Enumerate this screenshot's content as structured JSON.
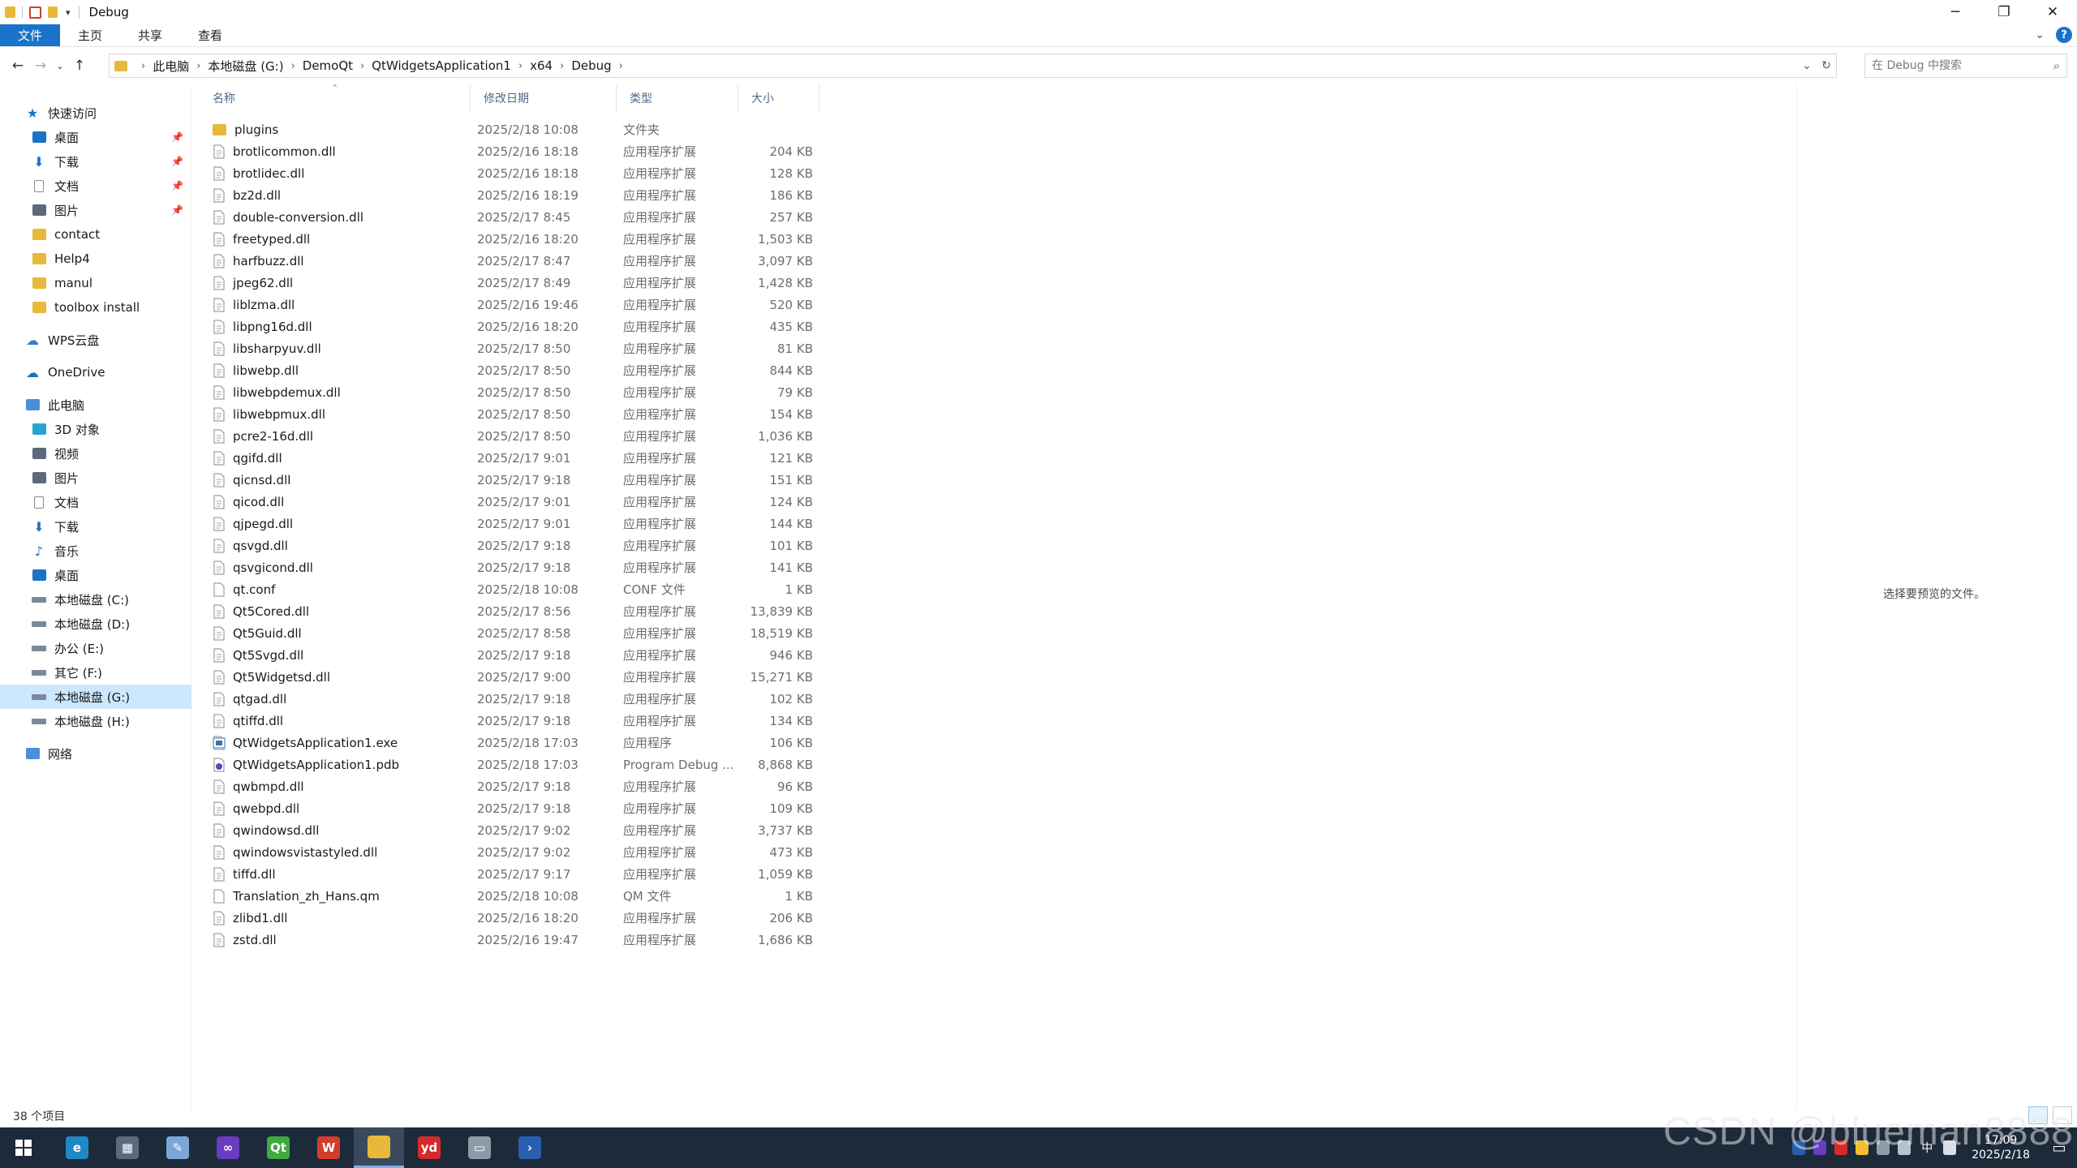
{
  "window": {
    "title": "Debug",
    "minimize": "─",
    "restore": "❐",
    "close": "✕"
  },
  "ribbon": {
    "tabs": [
      "文件",
      "主页",
      "共享",
      "查看"
    ],
    "help": "?"
  },
  "address": {
    "crumbs": [
      "此电脑",
      "本地磁盘 (G:)",
      "DemoQt",
      "QtWidgetsApplication1",
      "x64",
      "Debug"
    ]
  },
  "search": {
    "placeholder": "在 Debug 中搜索"
  },
  "sidebar": {
    "items": [
      {
        "label": "快速访问",
        "icon": "star-icon",
        "color": "#1a73c8",
        "pinned": false
      },
      {
        "label": "桌面",
        "icon": "desktop-icon",
        "color": "#1a73c8",
        "pinned": true
      },
      {
        "label": "下载",
        "icon": "download-icon",
        "color": "#1a73c8",
        "pinned": true
      },
      {
        "label": "文档",
        "icon": "document-icon",
        "color": "#8a8a8a",
        "pinned": true
      },
      {
        "label": "图片",
        "icon": "picture-icon",
        "color": "#5a6a7a",
        "pinned": true
      },
      {
        "label": "contact",
        "icon": "folder-icon",
        "color": "#e8b83a",
        "pinned": false
      },
      {
        "label": "Help4",
        "icon": "folder-icon",
        "color": "#e8b83a",
        "pinned": false
      },
      {
        "label": "manul",
        "icon": "folder-icon",
        "color": "#e8b83a",
        "pinned": false
      },
      {
        "label": "toolbox install",
        "icon": "folder-icon",
        "color": "#e8b83a",
        "pinned": false
      },
      {
        "label": "WPS云盘",
        "icon": "cloud-icon",
        "color": "#2f7ed8",
        "pinned": false
      },
      {
        "label": "OneDrive",
        "icon": "onedrive-icon",
        "color": "#1a73c8",
        "pinned": false
      },
      {
        "label": "此电脑",
        "icon": "computer-icon",
        "color": "#4a90d9",
        "pinned": false
      },
      {
        "label": "3D 对象",
        "icon": "3d-objects-icon",
        "color": "#29a3d6",
        "pinned": false
      },
      {
        "label": "视频",
        "icon": "video-icon",
        "color": "#5a6a7a",
        "pinned": false
      },
      {
        "label": "图片",
        "icon": "picture-icon",
        "color": "#5a6a7a",
        "pinned": false
      },
      {
        "label": "文档",
        "icon": "document-icon",
        "color": "#8a8a8a",
        "pinned": false
      },
      {
        "label": "下载",
        "icon": "download-icon",
        "color": "#1a73c8",
        "pinned": false
      },
      {
        "label": "音乐",
        "icon": "music-icon",
        "color": "#1a73c8",
        "pinned": false
      },
      {
        "label": "桌面",
        "icon": "desktop-icon",
        "color": "#1a73c8",
        "pinned": false
      },
      {
        "label": "本地磁盘 (C:)",
        "icon": "drive-icon",
        "color": "#7a8a9a",
        "pinned": false
      },
      {
        "label": "本地磁盘 (D:)",
        "icon": "drive-icon",
        "color": "#7a8a9a",
        "pinned": false
      },
      {
        "label": "办公 (E:)",
        "icon": "drive-icon",
        "color": "#7a8a9a",
        "pinned": false
      },
      {
        "label": "其它 (F:)",
        "icon": "drive-icon",
        "color": "#7a8a9a",
        "pinned": false
      },
      {
        "label": "本地磁盘 (G:)",
        "icon": "drive-icon",
        "color": "#7a8a9a",
        "pinned": false,
        "selected": true
      },
      {
        "label": "本地磁盘 (H:)",
        "icon": "drive-icon",
        "color": "#7a8a9a",
        "pinned": false
      },
      {
        "label": "网络",
        "icon": "network-icon",
        "color": "#4a90d9",
        "pinned": false
      }
    ]
  },
  "filelist": {
    "columns": [
      "名称",
      "修改日期",
      "类型",
      "大小"
    ],
    "files": [
      {
        "name": "plugins",
        "date": "2025/2/18 10:08",
        "type": "文件夹",
        "size": "",
        "icon": "folder-icon"
      },
      {
        "name": "brotlicommon.dll",
        "date": "2025/2/16 18:18",
        "type": "应用程序扩展",
        "size": "204 KB",
        "icon": "dll-icon"
      },
      {
        "name": "brotlidec.dll",
        "date": "2025/2/16 18:18",
        "type": "应用程序扩展",
        "size": "128 KB",
        "icon": "dll-icon"
      },
      {
        "name": "bz2d.dll",
        "date": "2025/2/16 18:19",
        "type": "应用程序扩展",
        "size": "186 KB",
        "icon": "dll-icon"
      },
      {
        "name": "double-conversion.dll",
        "date": "2025/2/17 8:45",
        "type": "应用程序扩展",
        "size": "257 KB",
        "icon": "dll-icon"
      },
      {
        "name": "freetyped.dll",
        "date": "2025/2/16 18:20",
        "type": "应用程序扩展",
        "size": "1,503 KB",
        "icon": "dll-icon"
      },
      {
        "name": "harfbuzz.dll",
        "date": "2025/2/17 8:47",
        "type": "应用程序扩展",
        "size": "3,097 KB",
        "icon": "dll-icon"
      },
      {
        "name": "jpeg62.dll",
        "date": "2025/2/17 8:49",
        "type": "应用程序扩展",
        "size": "1,428 KB",
        "icon": "dll-icon"
      },
      {
        "name": "liblzma.dll",
        "date": "2025/2/16 19:46",
        "type": "应用程序扩展",
        "size": "520 KB",
        "icon": "dll-icon"
      },
      {
        "name": "libpng16d.dll",
        "date": "2025/2/16 18:20",
        "type": "应用程序扩展",
        "size": "435 KB",
        "icon": "dll-icon"
      },
      {
        "name": "libsharpyuv.dll",
        "date": "2025/2/17 8:50",
        "type": "应用程序扩展",
        "size": "81 KB",
        "icon": "dll-icon"
      },
      {
        "name": "libwebp.dll",
        "date": "2025/2/17 8:50",
        "type": "应用程序扩展",
        "size": "844 KB",
        "icon": "dll-icon"
      },
      {
        "name": "libwebpdemux.dll",
        "date": "2025/2/17 8:50",
        "type": "应用程序扩展",
        "size": "79 KB",
        "icon": "dll-icon"
      },
      {
        "name": "libwebpmux.dll",
        "date": "2025/2/17 8:50",
        "type": "应用程序扩展",
        "size": "154 KB",
        "icon": "dll-icon"
      },
      {
        "name": "pcre2-16d.dll",
        "date": "2025/2/17 8:50",
        "type": "应用程序扩展",
        "size": "1,036 KB",
        "icon": "dll-icon"
      },
      {
        "name": "qgifd.dll",
        "date": "2025/2/17 9:01",
        "type": "应用程序扩展",
        "size": "121 KB",
        "icon": "dll-icon"
      },
      {
        "name": "qicnsd.dll",
        "date": "2025/2/17 9:18",
        "type": "应用程序扩展",
        "size": "151 KB",
        "icon": "dll-icon"
      },
      {
        "name": "qicod.dll",
        "date": "2025/2/17 9:01",
        "type": "应用程序扩展",
        "size": "124 KB",
        "icon": "dll-icon"
      },
      {
        "name": "qjpegd.dll",
        "date": "2025/2/17 9:01",
        "type": "应用程序扩展",
        "size": "144 KB",
        "icon": "dll-icon"
      },
      {
        "name": "qsvgd.dll",
        "date": "2025/2/17 9:18",
        "type": "应用程序扩展",
        "size": "101 KB",
        "icon": "dll-icon"
      },
      {
        "name": "qsvgicond.dll",
        "date": "2025/2/17 9:18",
        "type": "应用程序扩展",
        "size": "141 KB",
        "icon": "dll-icon"
      },
      {
        "name": "qt.conf",
        "date": "2025/2/18 10:08",
        "type": "CONF 文件",
        "size": "1 KB",
        "icon": "file-icon"
      },
      {
        "name": "Qt5Cored.dll",
        "date": "2025/2/17 8:56",
        "type": "应用程序扩展",
        "size": "13,839 KB",
        "icon": "dll-icon"
      },
      {
        "name": "Qt5Guid.dll",
        "date": "2025/2/17 8:58",
        "type": "应用程序扩展",
        "size": "18,519 KB",
        "icon": "dll-icon"
      },
      {
        "name": "Qt5Svgd.dll",
        "date": "2025/2/17 9:18",
        "type": "应用程序扩展",
        "size": "946 KB",
        "icon": "dll-icon"
      },
      {
        "name": "Qt5Widgetsd.dll",
        "date": "2025/2/17 9:00",
        "type": "应用程序扩展",
        "size": "15,271 KB",
        "icon": "dll-icon"
      },
      {
        "name": "qtgad.dll",
        "date": "2025/2/17 9:18",
        "type": "应用程序扩展",
        "size": "102 KB",
        "icon": "dll-icon"
      },
      {
        "name": "qtiffd.dll",
        "date": "2025/2/17 9:18",
        "type": "应用程序扩展",
        "size": "134 KB",
        "icon": "dll-icon"
      },
      {
        "name": "QtWidgetsApplication1.exe",
        "date": "2025/2/18 17:03",
        "type": "应用程序",
        "size": "106 KB",
        "icon": "exe-icon"
      },
      {
        "name": "QtWidgetsApplication1.pdb",
        "date": "2025/2/18 17:03",
        "type": "Program Debug ...",
        "size": "8,868 KB",
        "icon": "pdb-icon"
      },
      {
        "name": "qwbmpd.dll",
        "date": "2025/2/17 9:18",
        "type": "应用程序扩展",
        "size": "96 KB",
        "icon": "dll-icon"
      },
      {
        "name": "qwebpd.dll",
        "date": "2025/2/17 9:18",
        "type": "应用程序扩展",
        "size": "109 KB",
        "icon": "dll-icon"
      },
      {
        "name": "qwindowsd.dll",
        "date": "2025/2/17 9:02",
        "type": "应用程序扩展",
        "size": "3,737 KB",
        "icon": "dll-icon"
      },
      {
        "name": "qwindowsvistastyled.dll",
        "date": "2025/2/17 9:02",
        "type": "应用程序扩展",
        "size": "473 KB",
        "icon": "dll-icon"
      },
      {
        "name": "tiffd.dll",
        "date": "2025/2/17 9:17",
        "type": "应用程序扩展",
        "size": "1,059 KB",
        "icon": "dll-icon"
      },
      {
        "name": "Translation_zh_Hans.qm",
        "date": "2025/2/18 10:08",
        "type": "QM 文件",
        "size": "1 KB",
        "icon": "file-icon"
      },
      {
        "name": "zlibd1.dll",
        "date": "2025/2/16 18:20",
        "type": "应用程序扩展",
        "size": "206 KB",
        "icon": "dll-icon"
      },
      {
        "name": "zstd.dll",
        "date": "2025/2/16 19:47",
        "type": "应用程序扩展",
        "size": "1,686 KB",
        "icon": "dll-icon"
      }
    ]
  },
  "preview": {
    "message": "选择要预览的文件。"
  },
  "status": {
    "count": "38 个项目"
  },
  "taskbar": {
    "apps": [
      {
        "name": "edge-icon",
        "color": "#1e88c8",
        "glyph": "e",
        "active": false
      },
      {
        "name": "calculator-icon",
        "color": "#5b6b7b",
        "glyph": "▦",
        "active": false
      },
      {
        "name": "paint-icon",
        "color": "#7aa7d8",
        "glyph": "✎",
        "active": false
      },
      {
        "name": "visual-studio-icon",
        "color": "#6a3cc0",
        "glyph": "∞",
        "active": false
      },
      {
        "name": "qt-creator-icon",
        "color": "#41a940",
        "glyph": "Qt",
        "active": false
      },
      {
        "name": "wps-icon",
        "color": "#d43c2c",
        "glyph": "W",
        "active": false
      },
      {
        "name": "file-explorer-icon",
        "color": "#e8b83a",
        "glyph": "",
        "active": true
      },
      {
        "name": "youdao-icon",
        "color": "#d42a2a",
        "glyph": "yd",
        "active": false
      },
      {
        "name": "remote-desktop-icon",
        "color": "#8e9aa8",
        "glyph": "▭",
        "active": false
      },
      {
        "name": "powershell-icon",
        "color": "#2a5fb0",
        "glyph": "›",
        "active": false
      }
    ],
    "clock_time": "17:09",
    "clock_date": "2025/2/18",
    "ime": "中"
  },
  "watermark": "CSDN @blueman8888"
}
